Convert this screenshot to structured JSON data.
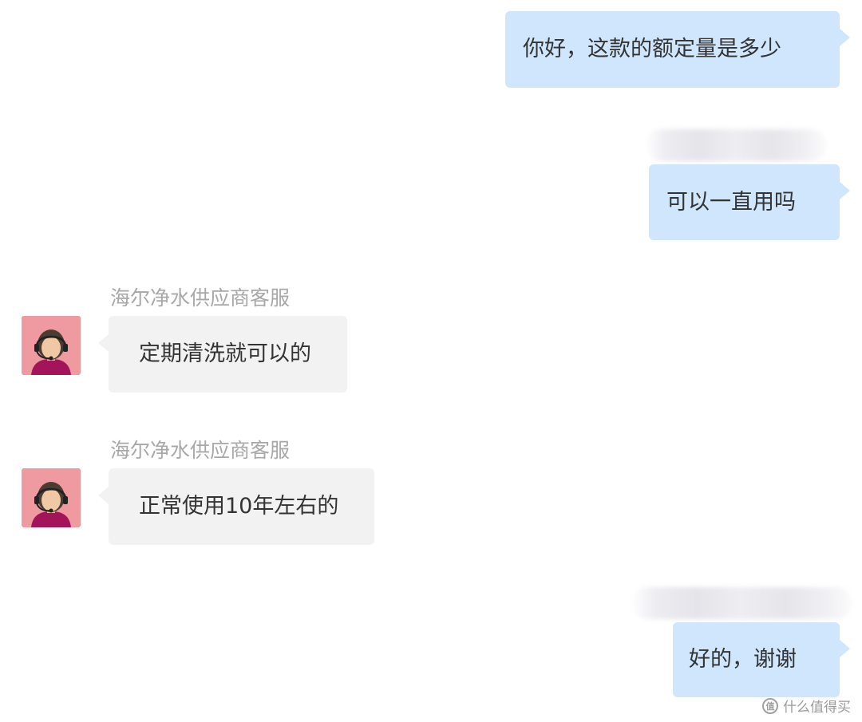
{
  "messages": [
    {
      "direction": "outgoing",
      "text": "你好，这款的额定量是多少"
    },
    {
      "direction": "outgoing",
      "text": "可以一直用吗"
    },
    {
      "direction": "incoming",
      "sender": "海尔净水供应商客服",
      "text": "定期清洗就可以的"
    },
    {
      "direction": "incoming",
      "sender": "海尔净水供应商客服",
      "text": "正常使用10年左右的"
    },
    {
      "direction": "outgoing",
      "text": "好的，谢谢"
    }
  ],
  "watermark": {
    "text": "什么值得买",
    "logo_glyph": "值"
  },
  "colors": {
    "outgoing_bubble": "#cfe6fd",
    "incoming_bubble": "#f2f2f2",
    "avatar_background": "#ef9aa0",
    "avatar_shirt": "#a3145a"
  },
  "icons": {
    "avatar": "customer-service-agent-headset-avatar",
    "watermark": "smzdm-logo-icon"
  }
}
